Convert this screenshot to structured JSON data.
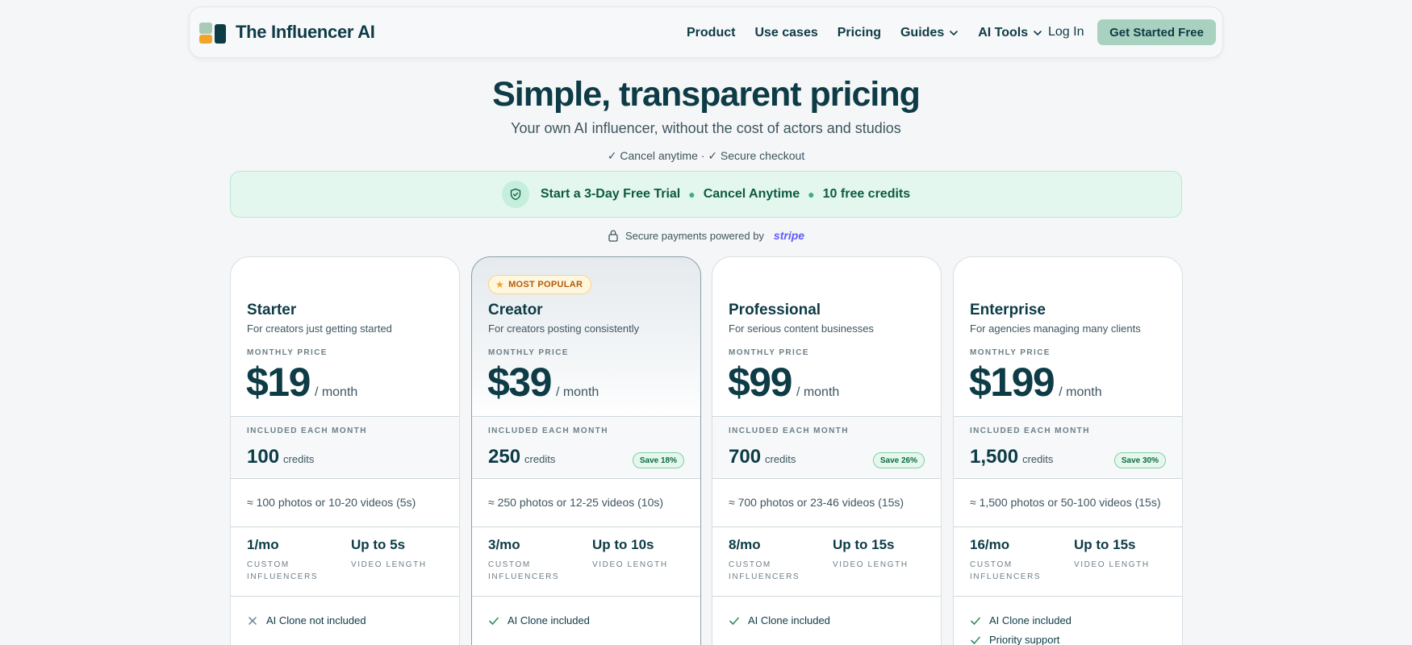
{
  "nav": {
    "brand": "The Influencer AI",
    "links": [
      {
        "label": "Product"
      },
      {
        "label": "Use cases"
      },
      {
        "label": "Pricing"
      },
      {
        "label": "Guides",
        "dropdown": true
      },
      {
        "label": "AI Tools",
        "dropdown": true
      }
    ],
    "login": "Log In",
    "cta": "Get Started Free"
  },
  "hero": {
    "title": "Simple, transparent pricing",
    "subtitle": "Your own AI influencer, without the cost of actors and studios",
    "checks": "✓ Cancel anytime · ✓ Secure checkout"
  },
  "trial_banner": {
    "item1": "Start a 3-Day Free Trial",
    "item2": "Cancel Anytime",
    "item3": "10 free credits"
  },
  "secure": {
    "text": "Secure payments powered by",
    "provider": "stripe"
  },
  "labels": {
    "monthly_price": "MONTHLY PRICE",
    "per": "/ month",
    "included": "INCLUDED EACH MONTH",
    "credits_unit": "credits",
    "custom_influencers": "CUSTOM INFLUENCERS",
    "video_length": "VIDEO LENGTH"
  },
  "plans": [
    {
      "name": "Starter",
      "description": "For creators just getting started",
      "price": "$19",
      "credits": "100",
      "save": "",
      "approx": "≈ 100 photos or 10-20 videos (5s)",
      "influencers": "1/mo",
      "video": "Up to 5s",
      "features": [
        {
          "text": "AI Clone not included",
          "included": false
        }
      ]
    },
    {
      "name": "Creator",
      "description": "For creators posting consistently",
      "badge": "MOST POPULAR",
      "price": "$39",
      "credits": "250",
      "save": "Save 18%",
      "approx": "≈ 250 photos or 12-25 videos (10s)",
      "influencers": "3/mo",
      "video": "Up to 10s",
      "features": [
        {
          "text": "AI Clone included",
          "included": true
        }
      ]
    },
    {
      "name": "Professional",
      "description": "For serious content businesses",
      "price": "$99",
      "credits": "700",
      "save": "Save 26%",
      "approx": "≈ 700 photos or 23-46 videos (15s)",
      "influencers": "8/mo",
      "video": "Up to 15s",
      "features": [
        {
          "text": "AI Clone included",
          "included": true
        }
      ]
    },
    {
      "name": "Enterprise",
      "description": "For agencies managing many clients",
      "price": "$199",
      "credits": "1,500",
      "save": "Save 30%",
      "approx": "≈ 1,500 photos or 50-100 videos (15s)",
      "influencers": "16/mo",
      "video": "Up to 15s",
      "features": [
        {
          "text": "AI Clone included",
          "included": true
        },
        {
          "text": "Priority support",
          "included": true
        }
      ]
    }
  ],
  "colors": {
    "primary": "#0d3b46",
    "cta": "#a8d2bf",
    "trial_bg": "#e3f7ee",
    "save_green": "#0d6b44",
    "badge_orange": "#b35b0a",
    "stripe": "#635bff"
  }
}
